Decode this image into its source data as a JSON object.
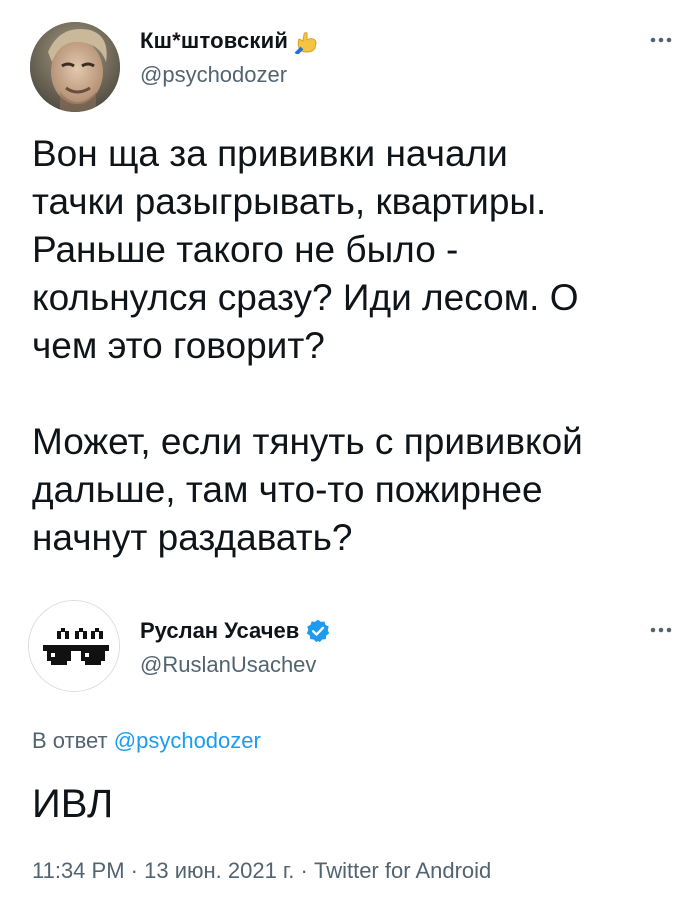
{
  "tweet": {
    "author_name": "Кш*штовский",
    "author_handle": "@psychodozer",
    "paragraphs": [
      "Вон ща за прививки начали\nтачки разыгрывать, квартиры.\nРаньше такого не было -\nкольнулся сразу? Иди лесом. О\nчем это говорит?",
      "Может, если тянуть с прививкой\nдальше, там что-то пожирнее\nначнут раздавать?"
    ]
  },
  "reply": {
    "author_name": "Руслан Усачев",
    "author_handle": "@RuslanUsachev",
    "reply_prefix": "В ответ",
    "reply_mention": "@psychodozer",
    "text": "ИВЛ",
    "time": "11:34 PM",
    "date": "13 июн. 2021 г.",
    "source": "Twitter for Android",
    "separator": "·"
  },
  "icons": {
    "name_emoji": "call-me-hand-icon",
    "verified": "verified-badge-icon",
    "more": "more-options-icon"
  },
  "colors": {
    "text": "#0f1419",
    "secondary": "#536471",
    "link": "#1d9bf0",
    "verified": "#1d9bf0"
  }
}
